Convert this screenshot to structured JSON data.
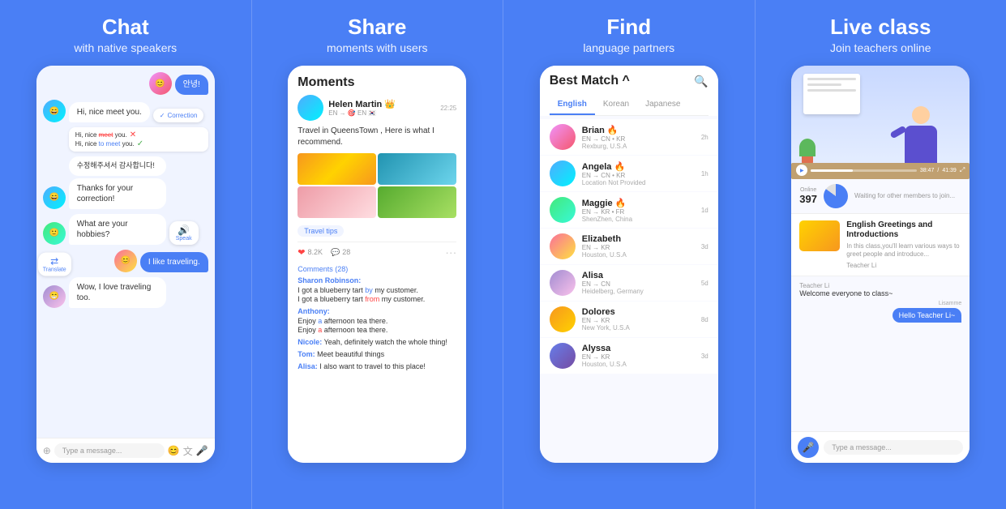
{
  "panel1": {
    "title": "Chat",
    "subtitle": "with native speakers",
    "messages": [
      {
        "type": "received",
        "text": "안녕!",
        "avatar": "av1"
      },
      {
        "type": "received",
        "text": "Hi, nice meet you.",
        "avatar": "av2"
      },
      {
        "type": "correction_badge",
        "label": "Correction"
      },
      {
        "type": "correction_block",
        "lines": [
          "Hi, nice meet you.",
          "Hi, nice to meet you."
        ]
      },
      {
        "type": "korean",
        "text": "수정해주셔서 감사합니다!",
        "avatar": "av2"
      },
      {
        "type": "received_sub",
        "text": "Thanks for your correction!",
        "avatar": "av2"
      },
      {
        "type": "received",
        "text": "What are your hobbies?",
        "avatar": "av3"
      },
      {
        "type": "speak_badge",
        "label": "Speak"
      },
      {
        "type": "sent",
        "text": "I like traveling.",
        "avatar": "av4"
      },
      {
        "type": "received",
        "text": "Wow, I love traveling too.",
        "avatar": "av5"
      }
    ],
    "input_placeholder": "Type a message..."
  },
  "panel2": {
    "title": "Share",
    "subtitle": "moments with users",
    "moments_title": "Moments",
    "author_name": "Helen Martin 👑",
    "author_langs": "EN → 🎯 EN 🇰🇷",
    "post_time": "22:25",
    "post_text": "Travel in QueensTown , Here is what I recommend.",
    "tag": "Travel tips",
    "likes": "8.2K",
    "comments_count": "28",
    "comments_label": "Comments (28)",
    "comments": [
      {
        "author": "Sharon Robinson:",
        "text": "I got a blueberry tart ",
        "highlight": "by",
        "rest": " my customer.",
        "text2": "I got a blueberry tart ",
        "highlight2": "from",
        "rest2": " my customer."
      },
      {
        "author": "Anthony:",
        "text": "Enjoy ",
        "highlight": "a",
        "rest": " afternoon tea there.",
        "text2": "Enjoy ",
        "highlight2": "a",
        "rest2": " afternoon tea there."
      },
      {
        "author": "Nicole:",
        "text": "Yeah, definitely watch the whole thing!"
      },
      {
        "author": "Tom:",
        "text": " Meet beautiful things"
      },
      {
        "author": "Alisa:",
        "text": " I also want to travel to this place!"
      }
    ]
  },
  "panel3": {
    "title": "Find",
    "subtitle": "language partners",
    "header_title": "Best Match ^",
    "tabs": [
      "English",
      "Korean",
      "Japanese"
    ],
    "active_tab": "English",
    "partners": [
      {
        "name": "Brian 🔥",
        "langs": "EN → CN • KR",
        "location": "Rexburg, U.S.A",
        "time": "2h"
      },
      {
        "name": "Angela 🔥",
        "langs": "EN → CN • KR",
        "location": "Location Not Provided",
        "time": "1h"
      },
      {
        "name": "Maggie 🔥",
        "langs": "EN → KR • FR",
        "location": "ShenZhen, China",
        "time": "1d"
      },
      {
        "name": "Elizabeth",
        "langs": "EN → KR",
        "location": "Houston, U.S.A",
        "time": "3d"
      },
      {
        "name": "Alisa",
        "langs": "EN → CN",
        "location": "Heidelberg, Germany",
        "time": "5d"
      },
      {
        "name": "Dolores",
        "langs": "EN → KR",
        "location": "New York, U.S.A",
        "time": "8d"
      },
      {
        "name": "Alyssa",
        "langs": "EN → KR",
        "location": "Houston, U.S.A",
        "time": "3d"
      }
    ]
  },
  "panel4": {
    "title": "Live class",
    "subtitle": "Join teachers online",
    "online_label": "Online",
    "online_count": "397",
    "waiting_text": "Waiting for other members to join...",
    "class_title": "English Greetings and Introductions",
    "class_desc": "In this class,you'll learn various ways to greet people and introduce...",
    "teacher_name": "Teacher Li",
    "welcome_msg": "Welcome everyone to class~",
    "msg_author": "Lisamme",
    "hello_msg": "Hello Teacher Li~",
    "time_played": "38:47",
    "time_total": "41:39",
    "input_placeholder": "Type a message...",
    "progress": "38"
  }
}
